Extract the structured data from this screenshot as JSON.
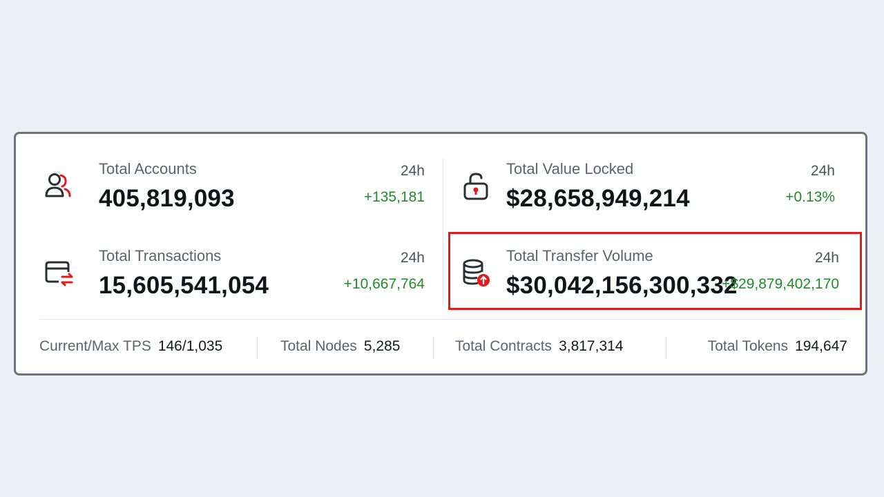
{
  "stats": {
    "accounts": {
      "label": "Total Accounts",
      "value": "405,819,093",
      "period": "24h",
      "change": "+135,181",
      "icon": "users-icon"
    },
    "tvl": {
      "label": "Total Value Locked",
      "value": "$28,658,949,214",
      "period": "24h",
      "change": "+0.13%",
      "icon": "unlock-icon"
    },
    "transactions": {
      "label": "Total Transactions",
      "value": "15,605,541,054",
      "period": "24h",
      "change": "+10,667,764",
      "icon": "card-transfer-icon"
    },
    "transfer_volume": {
      "label": "Total Transfer Volume",
      "value": "$30,042,156,300,332",
      "period": "24h",
      "change": "+$29,879,402,170",
      "icon": "database-upload-icon"
    }
  },
  "footer": {
    "tps": {
      "label": "Current/Max TPS",
      "value": "146/1,035"
    },
    "nodes": {
      "label": "Total Nodes",
      "value": "5,285"
    },
    "contracts": {
      "label": "Total Contracts",
      "value": "3,817,314"
    },
    "tokens": {
      "label": "Total Tokens",
      "value": "194,647"
    }
  },
  "colors": {
    "accent_red": "#e3191c",
    "positive_green": "#1f8a2a",
    "icon_dark": "#2b2e33"
  }
}
